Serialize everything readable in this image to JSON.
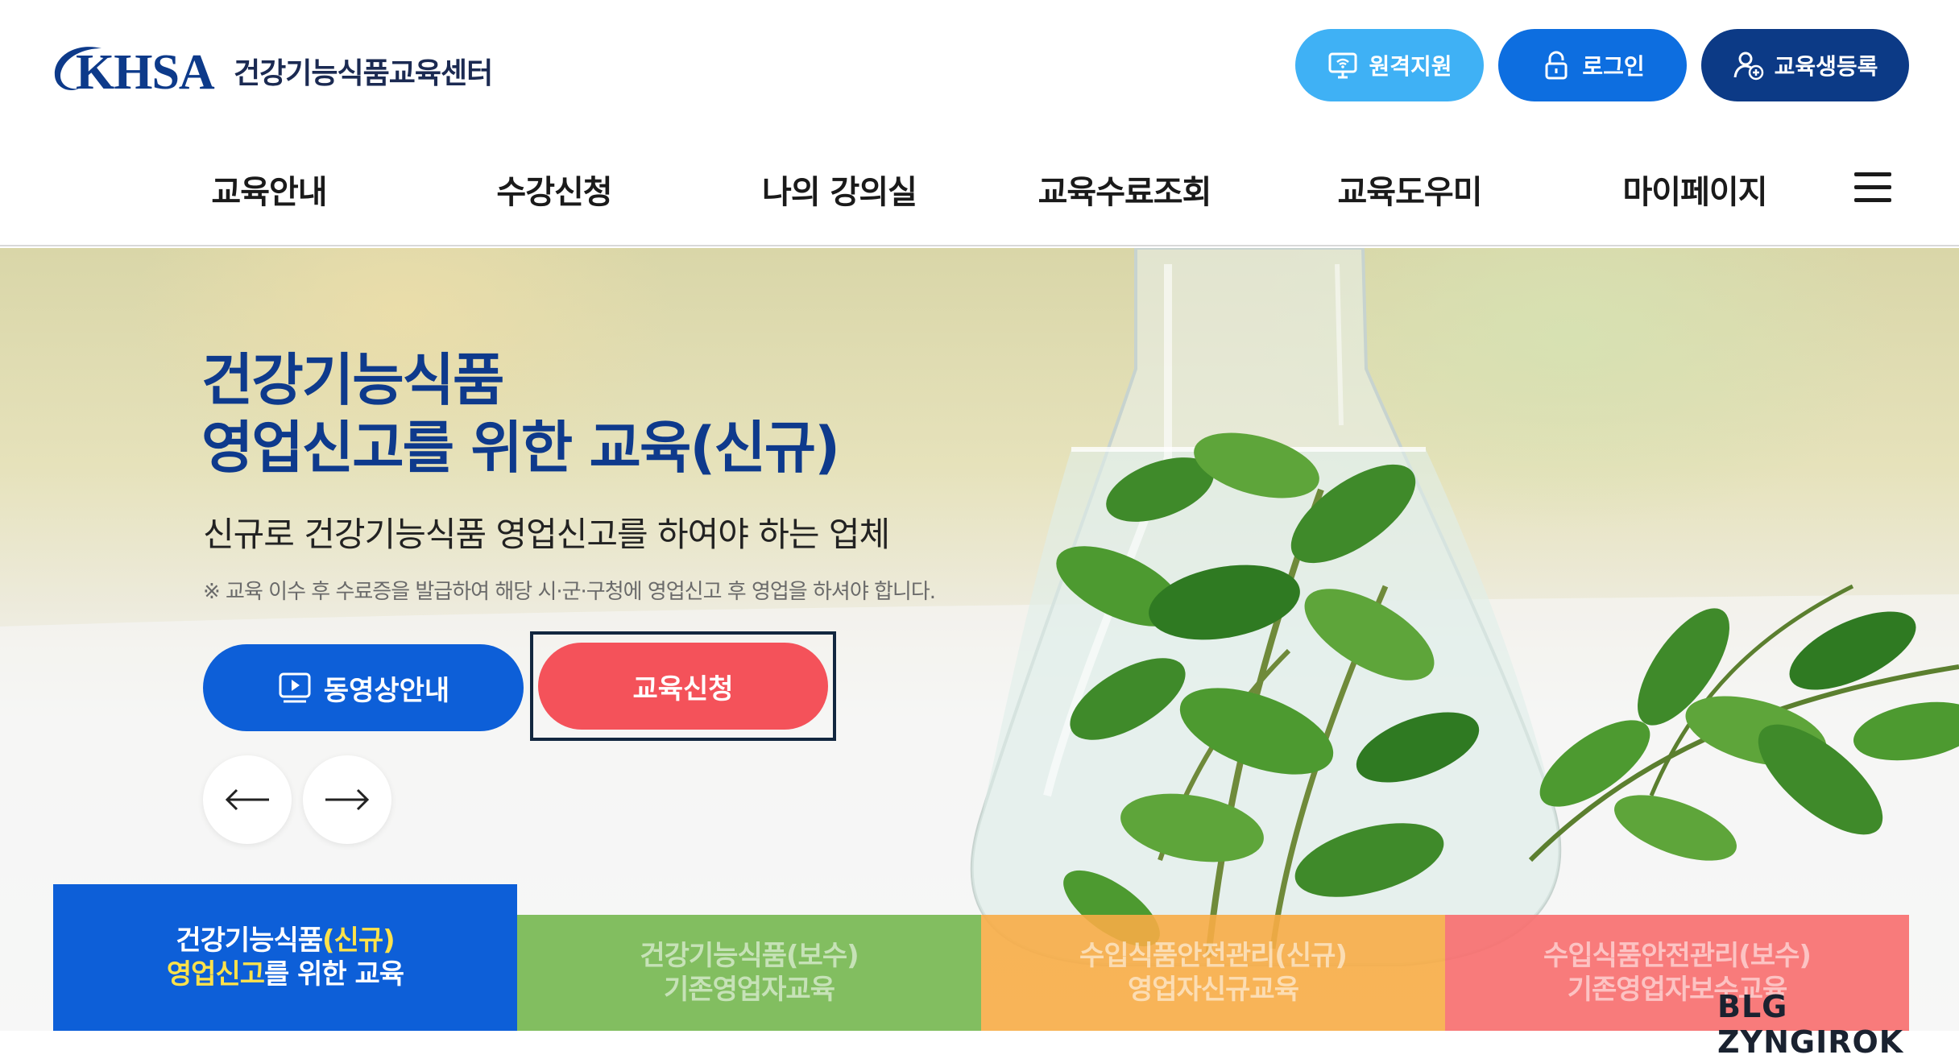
{
  "header": {
    "logo_text": "KHSA",
    "logo_subtitle": "건강기능식품교육센터",
    "buttons": {
      "remote": "원격지원",
      "login": "로그인",
      "register": "교육생등록"
    },
    "nav": [
      "교육안내",
      "수강신청",
      "나의 강의실",
      "교육수료조회",
      "교육도우미",
      "마이페이지"
    ]
  },
  "hero": {
    "title_line1": "건강기능식품",
    "title_line2": "영업신고를 위한 교육(신규)",
    "subtitle": "신규로 건강기능식품 영업신고를 하여야 하는 업체",
    "note": "※ 교육 이수 후 수료증을 발급하여 해당 시·군·구청에 영업신고 후 영업을 하셔야 합니다.",
    "video_button": "동영상안내",
    "apply_button": "교육신청"
  },
  "tabs": [
    {
      "line1_a": "건강기능식품",
      "line1_b": "(신규)",
      "line2_a": "영업신고",
      "line2_b": "를 위한 교육"
    },
    {
      "line1": "건강기능식품(보수)",
      "line2": "기존영업자교육"
    },
    {
      "line1": "수입식품안전관리(신규)",
      "line2": "영업자신규교육"
    },
    {
      "line1": "수입식품안전관리(보수)",
      "line2": "기존영업자보수교육"
    }
  ],
  "watermark": "BLG ZYNGIROK",
  "colors": {
    "navy": "#0e3a8c",
    "primary_blue": "#0d5fd8",
    "sky_blue": "#3fb1f5",
    "apply_red": "#f4525a",
    "tab_green": "#77b852",
    "tab_orange": "#f7ac46",
    "tab_pink": "#f77070",
    "highlight_yellow": "#ffe24a"
  }
}
